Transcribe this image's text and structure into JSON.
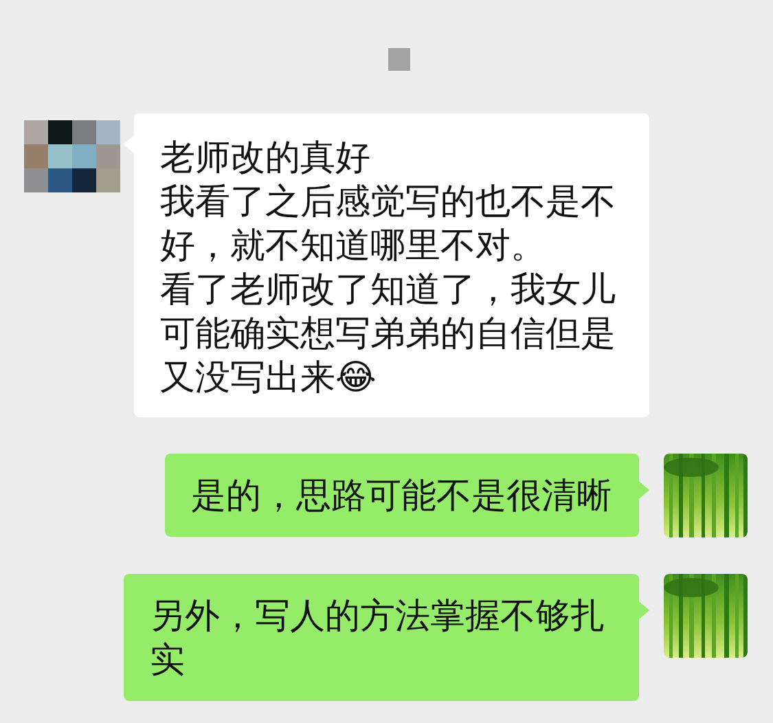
{
  "messages": [
    {
      "kind": "received",
      "paragraphs": [
        "老师改的真好",
        "我看了之后感觉写的也不是不好，就不知道哪里不对。",
        "看了老师改了知道了，我女儿可能确实想写弟弟的自信但是又没写出来😂"
      ]
    },
    {
      "kind": "sent",
      "paragraphs": [
        "是的，思路可能不是很清晰"
      ]
    },
    {
      "kind": "sent",
      "paragraphs": [
        "另外，写人的方法掌握不够扎实"
      ]
    }
  ]
}
